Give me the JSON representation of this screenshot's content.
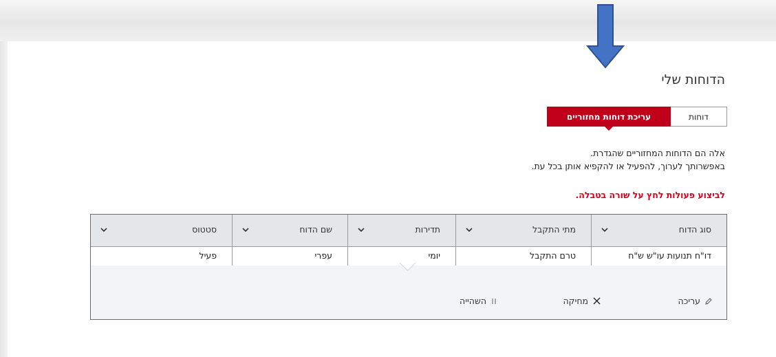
{
  "page_title": "הדוחות שלי",
  "tabs": [
    {
      "label": "דוחות",
      "active": false
    },
    {
      "label": "עריכת דוחות מחזוריים",
      "active": true
    }
  ],
  "description": {
    "line1": "אלה הם הדוחות המחזוריים שהגדרת.",
    "line2": "באפשרותך לערוך, להפעיל או להקפיא אותן בכל עת."
  },
  "hint": "לביצוע פעולות לחץ על שורה בטבלה.",
  "table": {
    "columns": [
      "סוג הדוח",
      "מתי התקבל",
      "תדירות",
      "שם הדוח",
      "סטטוס"
    ],
    "row": [
      "דו\"ח תנועות עו\"ש ש\"ח",
      "טרם התקבל",
      "יומי",
      "עפרי",
      "פעיל"
    ]
  },
  "actions": {
    "edit": "עריכה",
    "delete": "מחיקה",
    "suspend": "השהייה"
  },
  "colors": {
    "accent_red": "#c0001b",
    "hint_red": "#d8001c",
    "header_gray": "#e4e7ea",
    "arrow_blue": "#4472c4"
  }
}
